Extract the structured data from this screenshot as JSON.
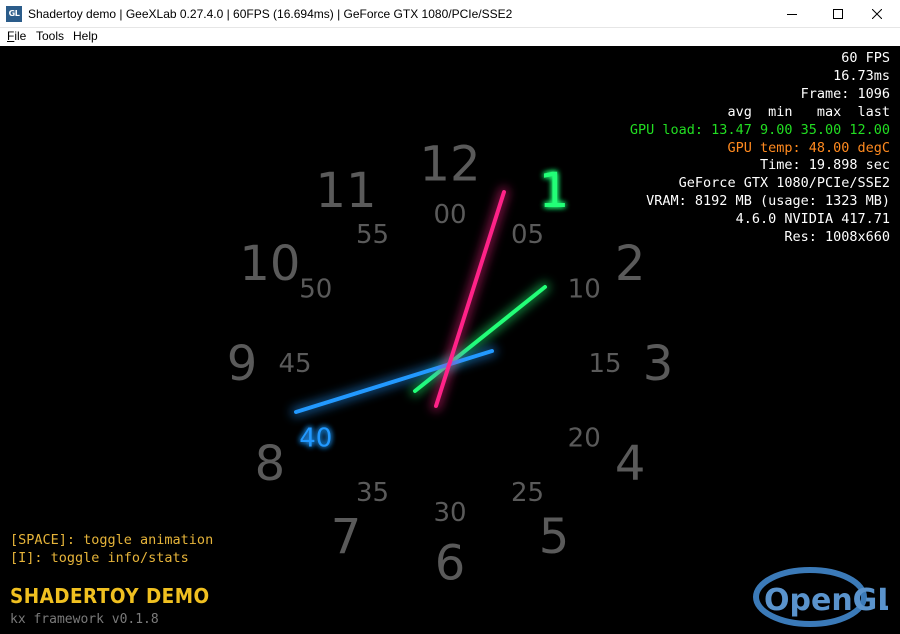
{
  "window": {
    "app_icon_text": "GL",
    "title": "Shadertoy demo | GeeXLab 0.27.4.0 | 60FPS (16.694ms) | GeForce GTX 1080/PCIe/SSE2"
  },
  "menu": {
    "items": [
      {
        "underlined": "F",
        "rest": "ile"
      },
      {
        "underlined": "",
        "rest": "Tools"
      },
      {
        "underlined": "",
        "rest": "Help"
      }
    ]
  },
  "clock": {
    "hours": [
      "12",
      "1",
      "2",
      "3",
      "4",
      "5",
      "6",
      "7",
      "8",
      "9",
      "10",
      "11"
    ],
    "minutes": [
      "00",
      "05",
      "10",
      "15",
      "20",
      "25",
      "30",
      "35",
      "40",
      "45",
      "50",
      "55"
    ],
    "highlighted_hour": "1",
    "highlighted_minute": "40",
    "colors": {
      "numbers": "#5a5a5a",
      "hour_hand": "#22ff77",
      "minute_hand": "#2299ff",
      "second_hand": "#ff2288"
    }
  },
  "stats": {
    "fps": "60 FPS",
    "ms": "16.73ms",
    "frame": "Frame: 1096",
    "header": "avg  min   max  last",
    "gpu_load": "GPU load: 13.47 9.00 35.00 12.00",
    "gpu_temp": "GPU temp: 48.00 degC",
    "time": "Time: 19.898 sec",
    "gpu_name": "GeForce GTX 1080/PCIe/SSE2",
    "vram": "VRAM: 8192 MB (usage: 1323 MB)",
    "driver": "4.6.0 NVIDIA 417.71",
    "res": "Res: 1008x660"
  },
  "help": {
    "space": "[SPACE]: toggle animation",
    "info": "[I]: toggle info/stats"
  },
  "branding": {
    "demo_title": "SHADERTOY DEMO",
    "framework": "kx framework v0.1.8",
    "logo_text": "OpenGL"
  }
}
